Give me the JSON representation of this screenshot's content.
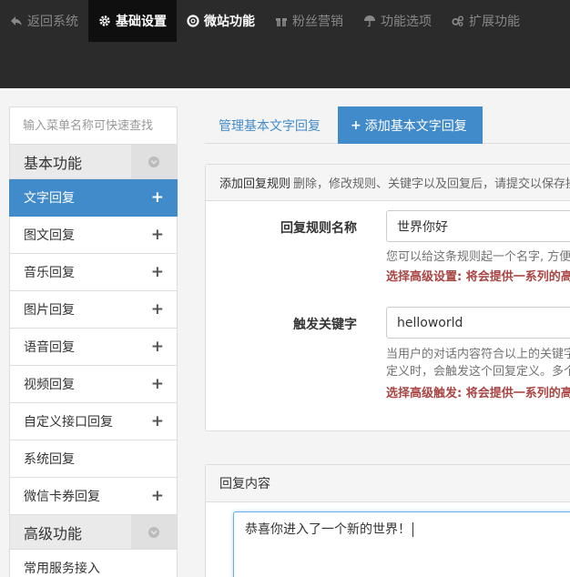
{
  "topnav": {
    "items": [
      {
        "label": "返回系统",
        "icon": "back-arrow-icon"
      },
      {
        "label": "基础设置",
        "icon": "gear-icon"
      },
      {
        "label": "微站功能",
        "icon": "lifebuoy-icon"
      },
      {
        "label": "粉丝营销",
        "icon": "gift-icon"
      },
      {
        "label": "功能选项",
        "icon": "umbrella-icon"
      },
      {
        "label": "扩展功能",
        "icon": "gears-icon"
      }
    ]
  },
  "sidebar": {
    "search_placeholder": "输入菜单名称可快速查找",
    "groups": [
      {
        "title": "基本功能",
        "items": [
          {
            "label": "文字回复",
            "plus": "+"
          },
          {
            "label": "图文回复",
            "plus": "+"
          },
          {
            "label": "音乐回复",
            "plus": "+"
          },
          {
            "label": "图片回复",
            "plus": "+"
          },
          {
            "label": "语音回复",
            "plus": "+"
          },
          {
            "label": "视频回复",
            "plus": "+"
          },
          {
            "label": "自定义接口回复",
            "plus": "+"
          },
          {
            "label": "系统回复"
          },
          {
            "label": "微信卡券回复",
            "plus": "+"
          }
        ]
      },
      {
        "title": "高级功能",
        "items": [
          {
            "label": "常用服务接入"
          }
        ]
      }
    ]
  },
  "tabs": {
    "manage": "管理基本文字回复",
    "add_plus": "+",
    "add": "添加基本文字回复"
  },
  "rule_panel": {
    "heading": "添加回复规则",
    "description": "删除，修改规则、关键字以及回复后，请提交以保存操作。",
    "name_label": "回复规则名称",
    "name_value": "世界你好",
    "name_help": "您可以给这条规则起一个名字, 方便下次修改和查看.",
    "name_warn": "选择高级设置: 将会提供一系列的高级选项",
    "keyword_label": "触发关键字",
    "keyword_value": "helloworld",
    "keyword_help": "当用户的对话内容符合以上的关键字定义时，会触发这个回复定义。多个关键字请使用逗号隔开，如 天气，今日天气 情",
    "keyword_warn": "选择高级触发: 将会提供一系列的高级触发方式"
  },
  "reply_panel": {
    "heading": "回复内容",
    "content": "恭喜你进入了一个新的世界！"
  },
  "colors": {
    "topbar": "#2b2b2b",
    "accent": "#428bca",
    "warn": "#a94442"
  }
}
